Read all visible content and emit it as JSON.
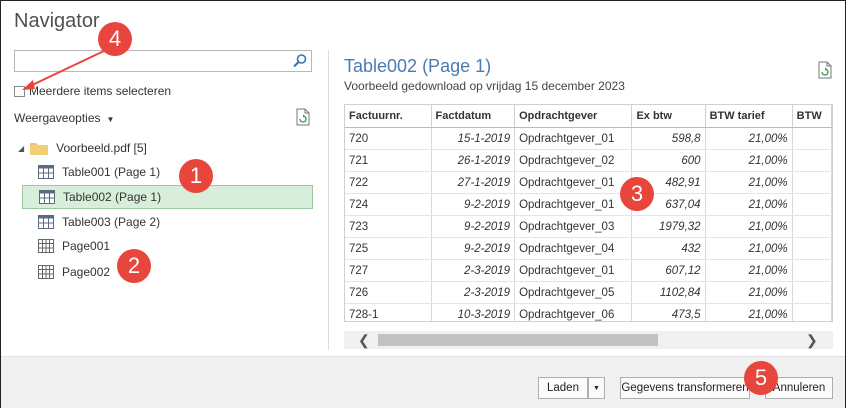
{
  "window": {
    "title": "Navigator"
  },
  "search": {
    "placeholder": "",
    "value": ""
  },
  "multi_select": {
    "label": "Meerdere items selecteren"
  },
  "view_options": {
    "label": "Weergaveopties"
  },
  "tree": {
    "root": "Voorbeeld.pdf [5]",
    "items": [
      {
        "label": "Table001 (Page 1)",
        "kind": "table",
        "selected": false
      },
      {
        "label": "Table002 (Page 1)",
        "kind": "table",
        "selected": true
      },
      {
        "label": "Table003 (Page 2)",
        "kind": "table",
        "selected": false
      },
      {
        "label": "Page001",
        "kind": "page",
        "selected": false
      },
      {
        "label": "Page002",
        "kind": "page",
        "selected": false
      }
    ]
  },
  "preview": {
    "title": "Table002 (Page 1)",
    "subtitle": "Voorbeeld gedownload op vrijdag 15 december 2023",
    "columns": [
      "Factuurnr.",
      "Factdatum",
      "Opdrachtgever",
      "Ex btw",
      "BTW tarief",
      "BTW"
    ],
    "rows": [
      [
        "720",
        "15-1-2019",
        "Opdrachtgever_01",
        "598,8",
        "21,00%",
        ""
      ],
      [
        "721",
        "26-1-2019",
        "Opdrachtgever_02",
        "600",
        "21,00%",
        ""
      ],
      [
        "722",
        "27-1-2019",
        "Opdrachtgever_01",
        "482,91",
        "21,00%",
        ""
      ],
      [
        "724",
        "9-2-2019",
        "Opdrachtgever_01",
        "637,04",
        "21,00%",
        ""
      ],
      [
        "723",
        "9-2-2019",
        "Opdrachtgever_03",
        "1979,32",
        "21,00%",
        ""
      ],
      [
        "725",
        "9-2-2019",
        "Opdrachtgever_04",
        "432",
        "21,00%",
        ""
      ],
      [
        "727",
        "2-3-2019",
        "Opdrachtgever_01",
        "607,12",
        "21,00%",
        ""
      ],
      [
        "726",
        "2-3-2019",
        "Opdrachtgever_05",
        "1102,84",
        "21,00%",
        ""
      ],
      [
        "728-1",
        "10-3-2019",
        "Opdrachtgever_06",
        "473,5",
        "21,00%",
        ""
      ]
    ]
  },
  "footer": {
    "load_label": "Laden",
    "transform_label": "Gegevens transformeren",
    "cancel_label": "Annuleren"
  },
  "annotations": [
    "1",
    "2",
    "3",
    "4",
    "5"
  ],
  "colors": {
    "accent": "#4a7bb1",
    "selected_bg": "#d8eedb",
    "badge": "#e8453c"
  }
}
